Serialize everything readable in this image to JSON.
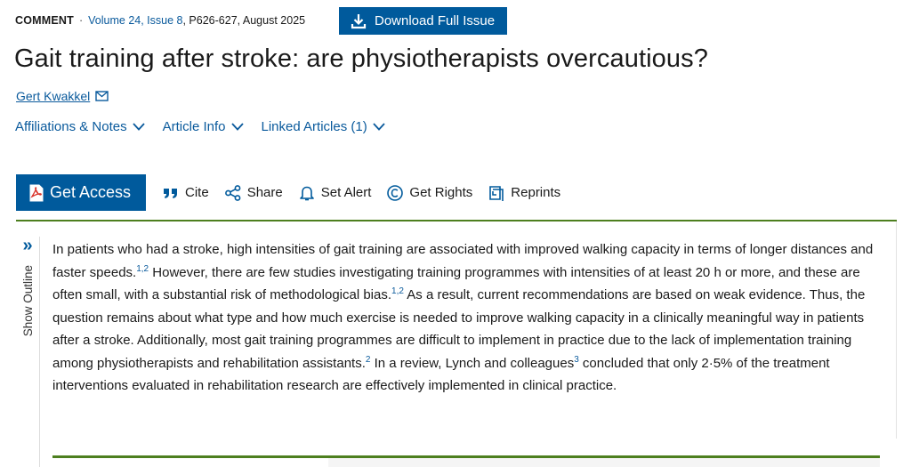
{
  "meta": {
    "type": "COMMENT",
    "separator": "·",
    "volume_issue": "Volume 24, Issue 8",
    "pages_date": ", P626-627, August 2025"
  },
  "download_button": {
    "label": "Download Full Issue",
    "icon": "download-icon"
  },
  "article": {
    "title": "Gait training after stroke: are physiotherapists overcautious?",
    "author": "Gert Kwakkel",
    "author_icon": "envelope-icon"
  },
  "info_tabs": [
    {
      "label": "Affiliations & Notes",
      "icon": "chevron-down-icon"
    },
    {
      "label": "Article Info",
      "icon": "chevron-down-icon"
    },
    {
      "label": "Linked Articles (1)",
      "icon": "chevron-down-icon"
    }
  ],
  "toolbar": {
    "get_access": "Get Access",
    "cite": "Cite",
    "share": "Share",
    "set_alert": "Set Alert",
    "get_rights": "Get Rights",
    "reprints": "Reprints"
  },
  "outline": {
    "toggle_glyph": "»",
    "label": "Show Outline"
  },
  "abstract": {
    "p1": "In patients who had a stroke, high intensities of gait training are associated with improved walking capacity in terms of longer distances and faster speeds.",
    "ref1": "1,2",
    "p2": " However, there are few studies investigating training programmes with intensities of at least 20 h or more, and these are often small, with a substantial risk of methodological bias.",
    "ref2": "1,2",
    "p3": " As a result, current recommendations are based on weak evidence. Thus, the question remains about what type and how much exercise is needed to improve walking capacity in a clinically meaningful way in patients after a stroke. Additionally, most gait training programmes are difficult to implement in practice due to the lack of implementation training among physiotherapists and rehabilitation assistants.",
    "ref3": "2",
    "p4": " In a review, Lynch and colleagues",
    "ref4": "3",
    "p5": " concluded that only 2·5% of the treatment interventions evaluated in rehabilitation research are effectively implemented in clinical practice."
  },
  "colors": {
    "brand_blue": "#005a9c",
    "link_blue": "#0a5a9c",
    "rule_green": "#4d7f1f",
    "pdf_red": "#d9342b"
  }
}
